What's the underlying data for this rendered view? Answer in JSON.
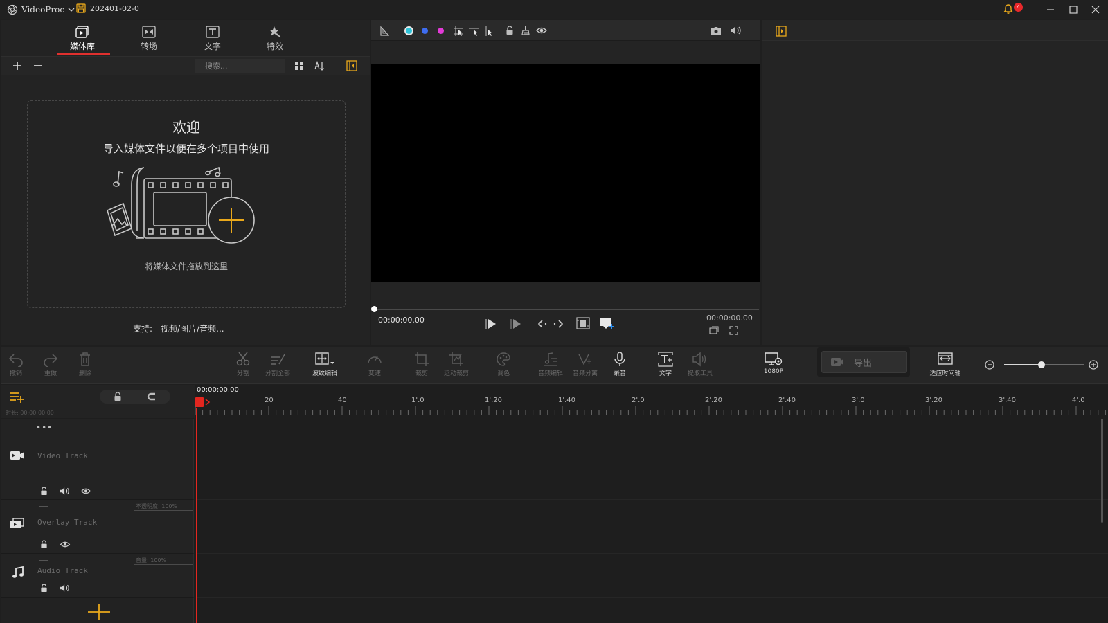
{
  "app": {
    "name": "VideoProc",
    "project_name": "202401-02-0",
    "notification_count": "4"
  },
  "media_panel": {
    "tabs": [
      {
        "label": "媒体库",
        "icon": "media-library-icon"
      },
      {
        "label": "转场",
        "icon": "transition-icon"
      },
      {
        "label": "文字",
        "icon": "text-icon"
      },
      {
        "label": "特效",
        "icon": "effects-icon"
      }
    ],
    "active_tab": "媒体库",
    "search_placeholder": "搜索...",
    "welcome_title": "欢迎",
    "welcome_subtitle": "导入媒体文件以便在多个项目中使用",
    "drop_hint": "将媒体文件拖放到这里",
    "support_label": "支持:",
    "support_value": "视频/图片/音频..."
  },
  "preview": {
    "current_time": "00:00:00.00",
    "total_time": "00:00:00.00",
    "color_dots": [
      "#2ec3d9",
      "#3e6df0",
      "#e23ad7"
    ]
  },
  "edit_toolbar": {
    "undo": "撤销",
    "redo": "重做",
    "delete": "删除",
    "split": "分割",
    "split_all": "分割全部",
    "transition_fx": "波纹编辑",
    "speed": "变速",
    "crop": "裁剪",
    "motion_crop": "运动裁剪",
    "color": "调色",
    "audio_edit": "音频编辑",
    "audio_split": "音频分离",
    "record": "录音",
    "text": "文字",
    "extract": "提取工具",
    "resolution": "1080P",
    "export": "导出",
    "fit_timeline": "适应时间轴"
  },
  "timeline": {
    "playhead_time": "00:00:00.00",
    "duration_label": "时长: 00:00:00.00",
    "ruler_labels": [
      "20",
      "40",
      "1'.0",
      "1'.20",
      "1'.40",
      "2'.0",
      "2'.20",
      "2'.40",
      "3'.0",
      "3'.20",
      "3'.40",
      "4'.0"
    ],
    "tracks": {
      "video": {
        "name": "Video Track"
      },
      "overlay": {
        "name": "Overlay Track",
        "field": "不透明度: 100%"
      },
      "audio": {
        "name": "Audio Track",
        "field": "音量: 100%"
      }
    }
  },
  "colors": {
    "accent_orange": "#e9a81b",
    "playhead_red": "#e4261f",
    "tab_underline": "#e0302e"
  }
}
